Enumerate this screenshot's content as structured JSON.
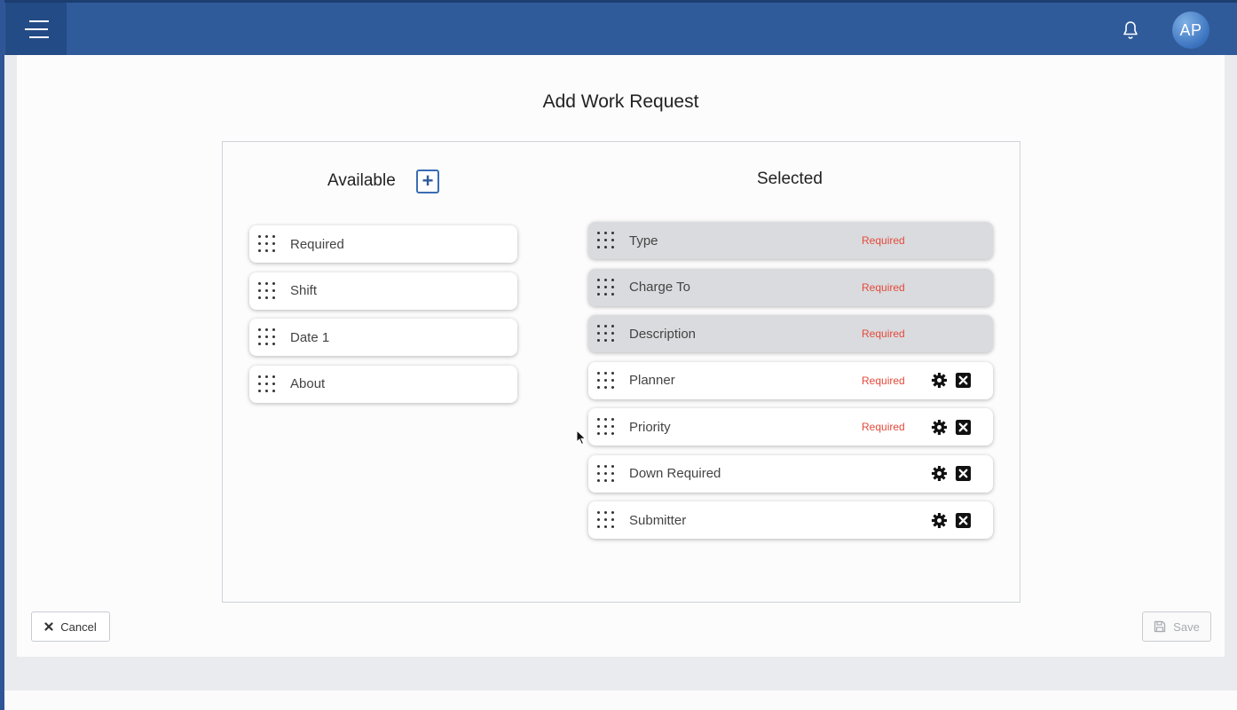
{
  "header": {
    "avatar_initials": "AP"
  },
  "page": {
    "title": "Add Work Request"
  },
  "available": {
    "title": "Available",
    "add_symbol": "+",
    "items": [
      {
        "label": "Required"
      },
      {
        "label": "Shift"
      },
      {
        "label": "Date 1"
      },
      {
        "label": "About"
      }
    ]
  },
  "selected": {
    "title": "Selected",
    "items": [
      {
        "label": "Type",
        "tag": "Required",
        "locked": true
      },
      {
        "label": "Charge To",
        "tag": "Required",
        "locked": true
      },
      {
        "label": "Description",
        "tag": "Required",
        "locked": true
      },
      {
        "label": "Planner",
        "tag": "Required",
        "locked": false
      },
      {
        "label": "Priority",
        "tag": "Required",
        "locked": false
      },
      {
        "label": "Down Required",
        "tag": "",
        "locked": false
      },
      {
        "label": "Submitter",
        "tag": "",
        "locked": false
      }
    ]
  },
  "footer": {
    "cancel_label": "Cancel",
    "save_label": "Save"
  },
  "colors": {
    "header": "#2f5b9a",
    "required": "#e5493a",
    "accent": "#3a6db5"
  },
  "icons": {
    "menu": "hamburger-icon",
    "bell": "bell-icon",
    "add": "plus-icon",
    "drag": "drag-grip-icon",
    "settings": "gear-icon",
    "remove": "close-box-icon",
    "cancel": "x-icon",
    "save": "floppy-disk-icon"
  }
}
